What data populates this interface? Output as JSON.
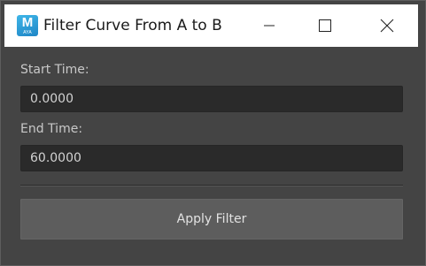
{
  "window": {
    "title": "Filter Curve From A to B",
    "app_icon": {
      "name": "maya-icon",
      "letter": "M",
      "sublabel": "AYA"
    },
    "controls": {
      "minimize_icon": "minimize-icon",
      "maximize_icon": "maximize-icon",
      "close_icon": "close-icon"
    }
  },
  "form": {
    "start_time": {
      "label": "Start Time:",
      "value": "0.0000"
    },
    "end_time": {
      "label": "End Time:",
      "value": "60.0000"
    },
    "apply_button_label": "Apply Filter"
  },
  "colors": {
    "title_bar": "#ffffff",
    "window_bg": "#444444",
    "field_bg": "#2a2a2a",
    "button_bg": "#5d5d5d",
    "app_icon": "#2a9ad6"
  }
}
